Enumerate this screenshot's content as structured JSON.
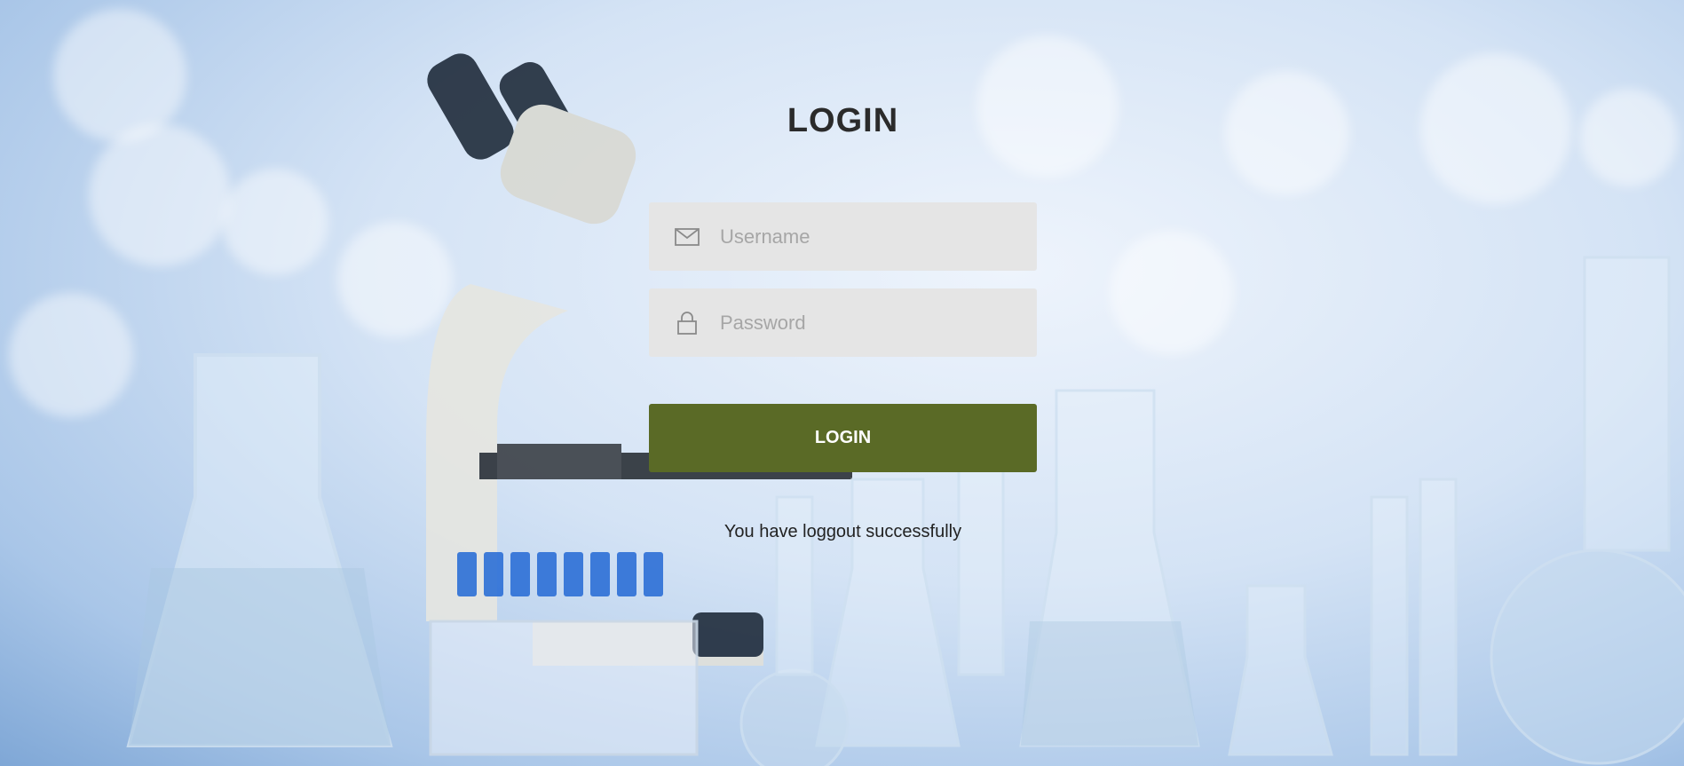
{
  "login": {
    "title": "LOGIN",
    "username_placeholder": "Username",
    "password_placeholder": "Password",
    "button_label": "LOGIN",
    "status_message": "You have loggout successfully"
  },
  "theme": {
    "button_color": "#5a6a26",
    "field_bg": "#e5e5e5",
    "title_color": "#2b2b2b"
  },
  "icons": {
    "username": "envelope-icon",
    "password": "lock-icon"
  }
}
